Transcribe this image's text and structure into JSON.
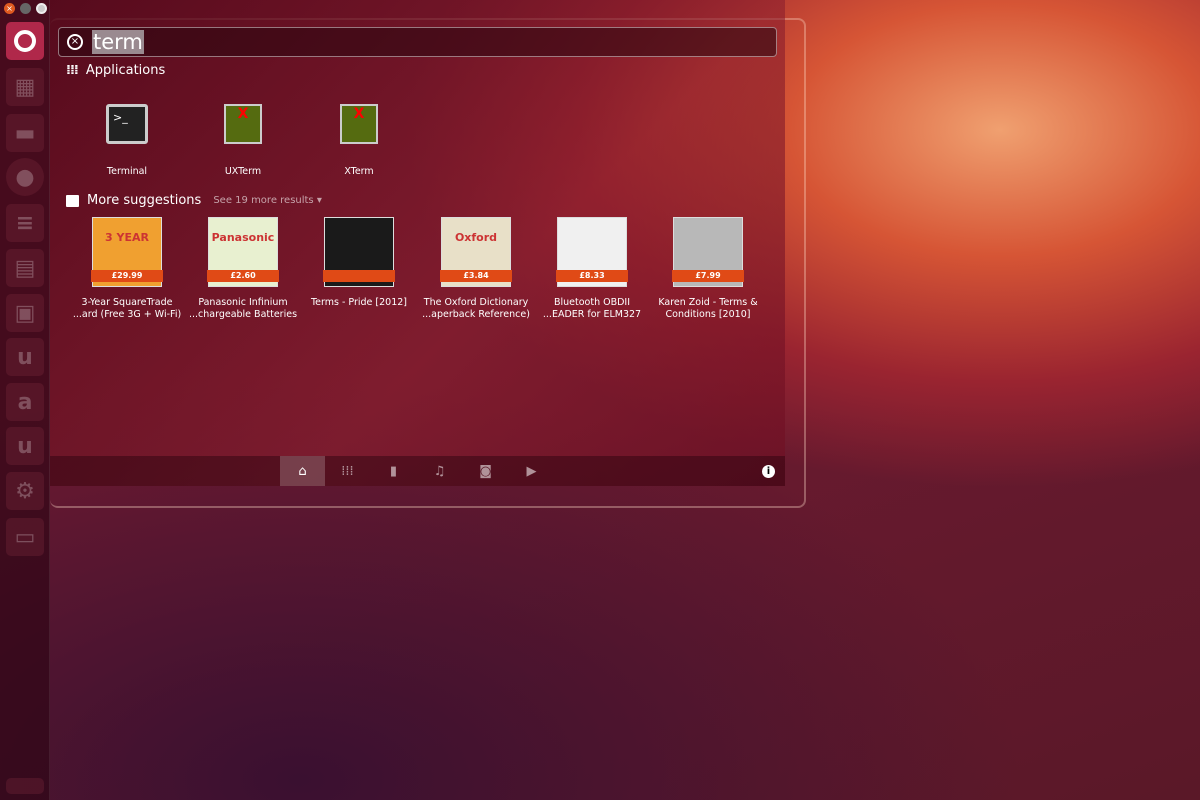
{
  "search": {
    "query": "term"
  },
  "applications": {
    "label": "Applications",
    "items": [
      {
        "name": "Terminal"
      },
      {
        "name": "UXTerm"
      },
      {
        "name": "XTerm"
      }
    ]
  },
  "suggestions": {
    "label": "More suggestions",
    "more": "See 19 more results",
    "items": [
      {
        "line1": "3-Year SquareTrade",
        "line2": "...ard (Free 3G + Wi-Fi)",
        "price": "£29.99",
        "img_text": "3 YEAR",
        "color": "#f0a030"
      },
      {
        "line1": "Panasonic Infinium",
        "line2": "...chargeable Batteries",
        "price": "£2.60",
        "img_text": "Panasonic",
        "color": "#e8f0d0"
      },
      {
        "line1": "Terms - Pride [2012]",
        "line2": "",
        "price": "",
        "img_text": "",
        "color": "#1a1a1a"
      },
      {
        "line1": "The Oxford Dictionary",
        "line2": "...aperback Reference)",
        "price": "£3.84",
        "img_text": "Oxford",
        "color": "#e8e0c8"
      },
      {
        "line1": "Bluetooth OBDII",
        "line2": "...EADER for ELM327",
        "price": "£8.33",
        "img_text": "",
        "color": "#f0f0f0"
      },
      {
        "line1": "Karen Zoid - Terms &",
        "line2": "Conditions [2010]",
        "price": "£7.99",
        "img_text": "",
        "color": "#b8b8b8"
      }
    ]
  },
  "filters": [
    "home-icon",
    "applications-icon",
    "files-icon",
    "music-icon",
    "photos-icon",
    "video-icon"
  ]
}
